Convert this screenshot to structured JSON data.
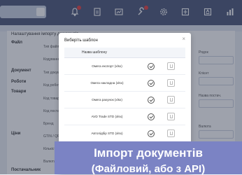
{
  "bg": {
    "panel_title": "Налаштування імпорту документів",
    "sections": [
      "Файл",
      "Документ",
      "Роботи",
      "Товари",
      "Ціни",
      "Постачальник"
    ],
    "labels": [
      "Тип файлу",
      "Кодування",
      "Тип документу",
      "Код роботи",
      "Код товару",
      "Код постачальника",
      "Бренд",
      "GTIN / QR",
      "Кількість",
      "Валюта"
    ],
    "right_labels": [
      "Рядок",
      "Клієнт",
      "Назва постач.",
      "Валюта"
    ]
  },
  "modal": {
    "title": "Виберіть шаблон",
    "close_label": "×",
    "column_name": "Назва шаблону",
    "rows": [
      "Омега експорт (xlsx)",
      "Омега накладна (xlsx)",
      "Омега рахунок (xlsx)",
      "AVD Trade STD (xlsx)",
      "Автопідбір STD (xlsx)",
      "VIP Autoparts (xlsx)"
    ]
  },
  "banner": {
    "line1": "Імпорт документів",
    "line2": "(Файловий, або з API)"
  },
  "icons": [
    "search-icon",
    "bell-icon",
    "document-icon",
    "chart-icon",
    "wrench-icon",
    "gear-icon",
    "export-icon",
    "report-icon",
    "bar-chart-icon"
  ],
  "colors": {
    "topbar": "#4c5679",
    "banner": "#7b83c4",
    "notification": "#e53e3e"
  }
}
